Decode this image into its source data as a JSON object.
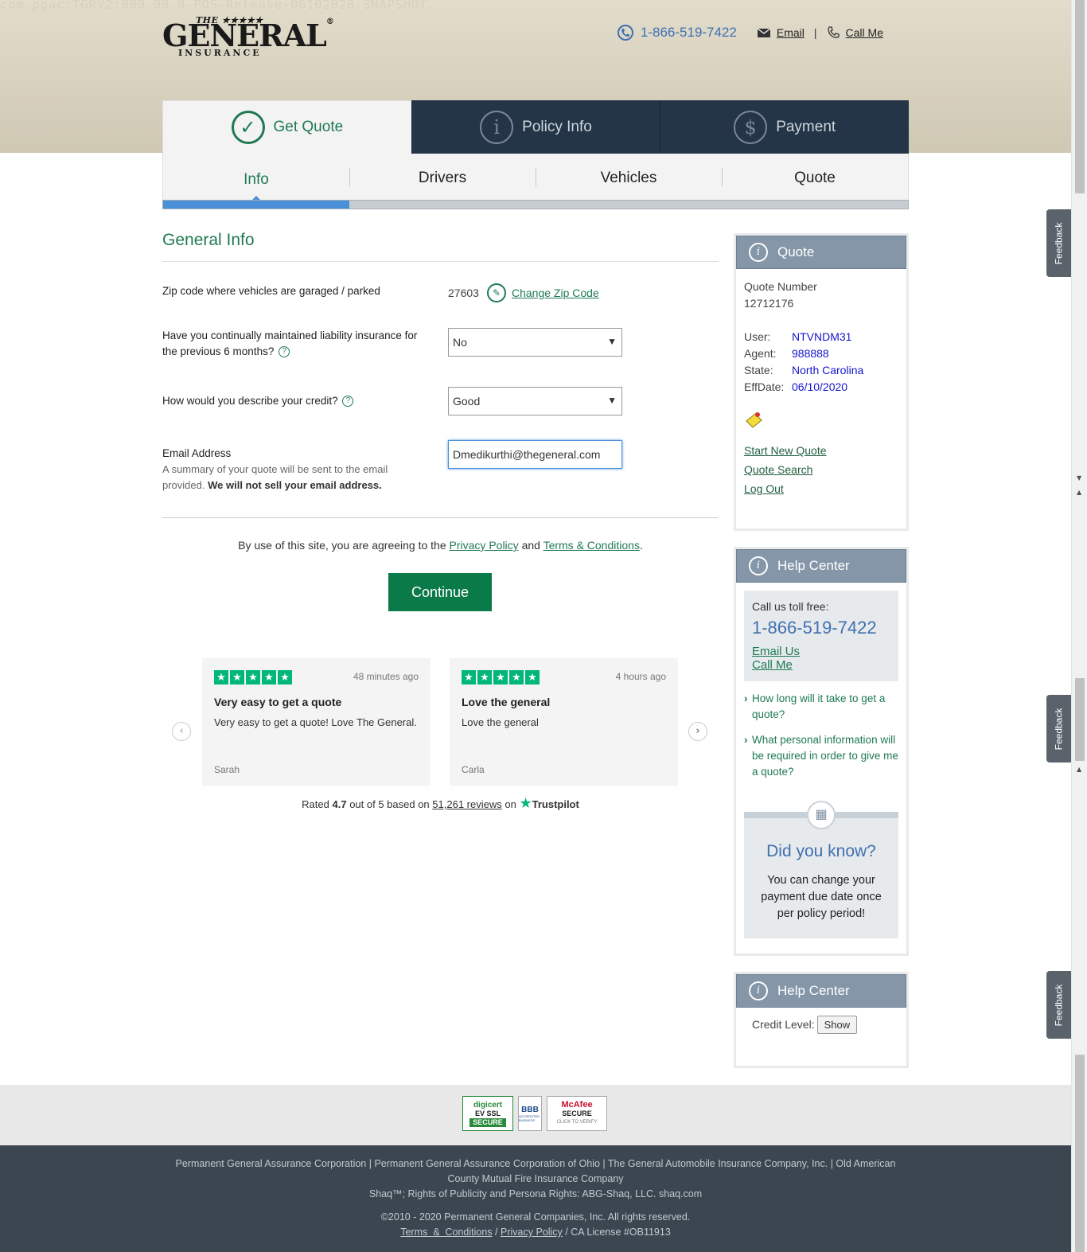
{
  "build_watermark": "com.pgac:TGRV2:999.99.9-POS-Release-06102020-SNAPSHOT",
  "brand": {
    "the": "THE ★★★★★",
    "name": "GENERAL",
    "reg": "®",
    "sub": "INSURANCE",
    "accent_color": "#1f7a52",
    "navy_color": "#243548"
  },
  "header": {
    "phone": "1-866-519-7422",
    "email_label": "Email",
    "sep": "|",
    "call_label": "Call Me"
  },
  "main_tabs": [
    {
      "label": "Get Quote",
      "icon": "check-circle-icon",
      "active": true
    },
    {
      "label": "Policy Info",
      "icon": "info-circle-icon",
      "active": false
    },
    {
      "label": "Payment",
      "icon": "dollar-circle-icon",
      "active": false
    }
  ],
  "sub_tabs": [
    {
      "label": "Info",
      "active": true
    },
    {
      "label": "Drivers",
      "active": false
    },
    {
      "label": "Vehicles",
      "active": false
    },
    {
      "label": "Quote",
      "active": false
    }
  ],
  "progress_fraction": 0.25,
  "form": {
    "title": "General Info",
    "zip_label": "Zip code where vehicles are garaged / parked",
    "zip_value": "27603",
    "change_zip": "Change Zip Code",
    "liability_label": "Have you continually maintained liability insurance for the previous 6 months?",
    "liability_value": "No",
    "credit_label": "How would you describe your credit?",
    "credit_value": "Good",
    "email_label": "Email Address",
    "email_help": "A summary of your quote will be sent to the email provided.",
    "email_help_bold": "We will not sell your email address.",
    "email_value": "Dmedikurthi@thegeneral.com"
  },
  "agree": {
    "prefix": "By use of this site, you are agreeing to the",
    "privacy": "Privacy Policy",
    "and": "and",
    "terms": "Terms & Conditions",
    "suffix": "."
  },
  "continue_label": "Continue",
  "reviews": [
    {
      "time": "48 minutes ago",
      "title": "Very easy to get a quote",
      "body": "Very easy to get a quote! Love The General.",
      "author": "Sarah",
      "stars": 5
    },
    {
      "time": "4 hours ago",
      "title": "Love the general",
      "body": "Love the general",
      "author": "Carla",
      "stars": 5
    }
  ],
  "trustpilot": {
    "rated": "Rated",
    "score": "4.7",
    "mid": "out of 5 based on",
    "count": "51,261 reviews",
    "on": "on",
    "brand": "Trustpilot"
  },
  "quote_panel": {
    "title": "Quote",
    "number_label": "Quote Number",
    "number": "12712176",
    "fields": [
      {
        "k": "User:",
        "v": "NTVNDM31"
      },
      {
        "k": "Agent:",
        "v": "988888"
      },
      {
        "k": "State:",
        "v": "North Carolina"
      },
      {
        "k": "EffDate:",
        "v": "06/10/2020"
      }
    ],
    "links": [
      "Start New Quote",
      "Quote Search",
      "Log Out"
    ]
  },
  "help_center": {
    "title": "Help Center",
    "toll_free": "Call us toll free:",
    "phone": "1-866-519-7422",
    "email_us": "Email Us",
    "call_me": "Call Me",
    "faqs": [
      "How long will it take to get a quote?",
      "What personal information will be required in order to give me a quote?"
    ],
    "dyk_title": "Did you know?",
    "dyk_body": "You can change your payment due date once per policy period!"
  },
  "help_center2": {
    "title": "Help Center",
    "credit_label": "Credit Level:",
    "show": "Show"
  },
  "feedback_label": "Feedback",
  "badges": {
    "digicert": {
      "brand": "digicert",
      "type": "EV SSL",
      "status": "SECURE"
    },
    "bbb": {
      "brand": "BBB",
      "status": "ACCREDITED BUSINESS"
    },
    "mcafee": {
      "brand": "McAfee",
      "type": "SECURE",
      "action": "CLICK TO VERIFY"
    }
  },
  "footer": {
    "line1": "Permanent General Assurance Corporation | Permanent General Assurance Corporation of Ohio | The General Automobile Insurance Company, Inc. | Old American County Mutual Fire Insurance Company",
    "line2": "Shaq™; Rights of Publicity and Persona Rights: ABG-Shaq, LLC. shaq.com",
    "copyright": "©2010 - 2020 Permanent General Companies, Inc. All rights reserved.",
    "terms": "Terms  &  Conditions",
    "sep": "/",
    "privacy": "Privacy Policy",
    "license": "/ CA License #OB11913"
  }
}
